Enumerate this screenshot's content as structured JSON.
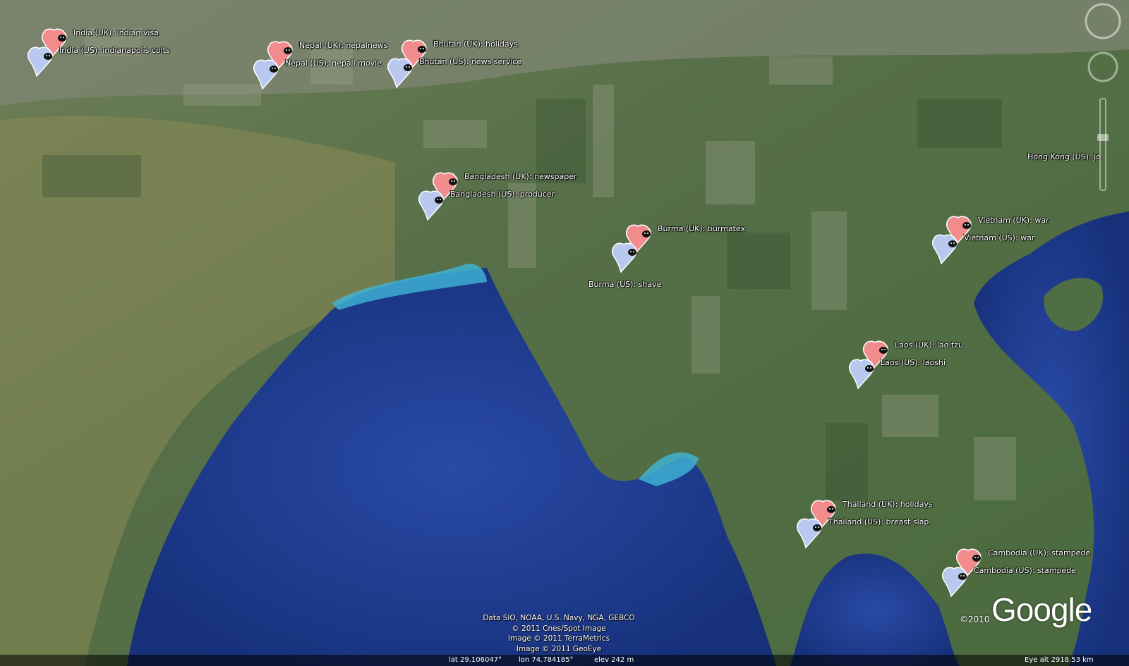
{
  "map": {
    "colors": {
      "ocean": "#1f3a8c",
      "land": "#5f7a52",
      "uk_pin": "#f28b8b",
      "us_pin": "#b9c8ee"
    },
    "markers": [
      {
        "uk": "India (UK): indian visa",
        "us": "India (US): indianapolis colts"
      },
      {
        "uk": "Nepal (UK): nepalnews",
        "us": "Nepal (US): nepali movie"
      },
      {
        "uk": "Bhutan (UK): holidays",
        "us": "Bhutan (US): news service"
      },
      {
        "uk": "Bangladesh (UK): newspaper",
        "us": "Bangladesh (US): producer"
      },
      {
        "uk": "Burma (UK): burmatex",
        "us": "Burma (US): shave"
      },
      {
        "uk": "Vietnam (UK): war",
        "us": "Vietnam (US): war"
      },
      {
        "uk": "Laos (UK): lao tzu",
        "us": "Laos (US): laoshi"
      },
      {
        "uk": "Thailand (UK): holidays",
        "us": "Thailand (US): breast slap"
      },
      {
        "uk": "Cambodia (UK): stampede",
        "us": "Cambodia (US): stampede"
      }
    ],
    "hongkong_label": "Hong Kong (US): jo",
    "credits": [
      "Data SIO, NOAA, U.S. Navy, NGA, GEBCO",
      "© 2011 Cnes/Spot Image",
      "Image © 2011 TerraMetrics",
      "Image © 2011 GeoEye"
    ],
    "copyright": "©2010",
    "logo": "Google",
    "status": {
      "lat": "lat   29.106047°",
      "lon": "lon   74.784185°",
      "elev": "elev  242 m",
      "eye": "Eye alt  2918.53 km"
    }
  }
}
